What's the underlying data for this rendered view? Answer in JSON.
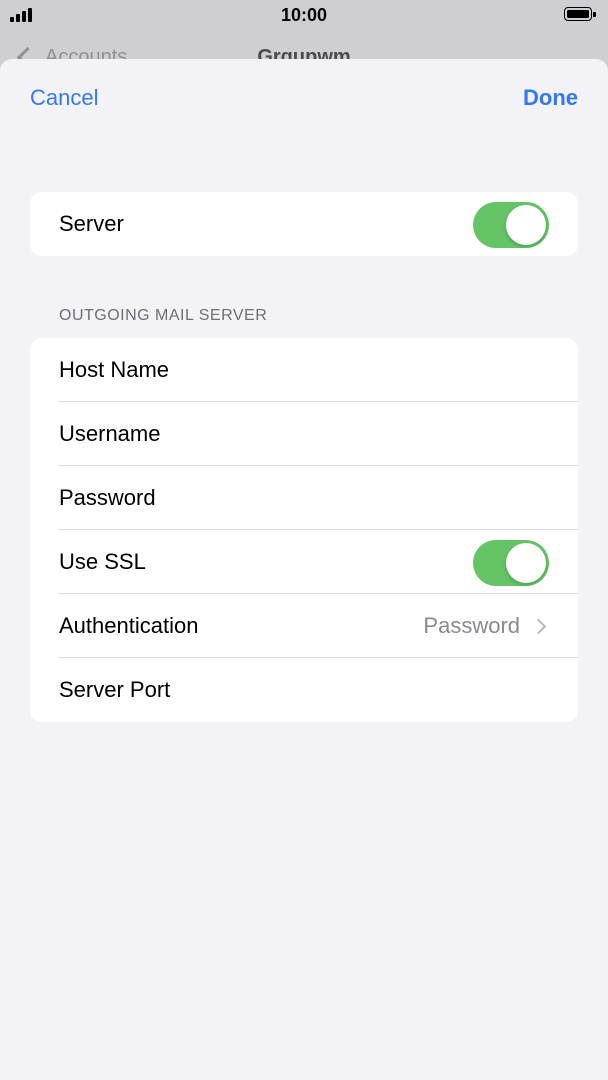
{
  "status_bar": {
    "time": "10:00"
  },
  "background_nav": {
    "back_label": "Accounts",
    "title": "Grqupwm"
  },
  "sheet_nav": {
    "cancel_label": "Cancel",
    "done_label": "Done"
  },
  "server_section": {
    "rows": [
      {
        "label": "Server",
        "toggle": true
      }
    ]
  },
  "outgoing_section": {
    "header": "OUTGOING MAIL SERVER",
    "rows": [
      {
        "label": "Host Name"
      },
      {
        "label": "Username"
      },
      {
        "label": "Password"
      },
      {
        "label": "Use SSL",
        "toggle": true
      },
      {
        "label": "Authentication",
        "value": "Password"
      },
      {
        "label": "Server Port"
      }
    ]
  },
  "colors": {
    "accent": "#3478f6",
    "toggle_on": "#65c466",
    "sheet_bg": "#f2f2f7"
  }
}
